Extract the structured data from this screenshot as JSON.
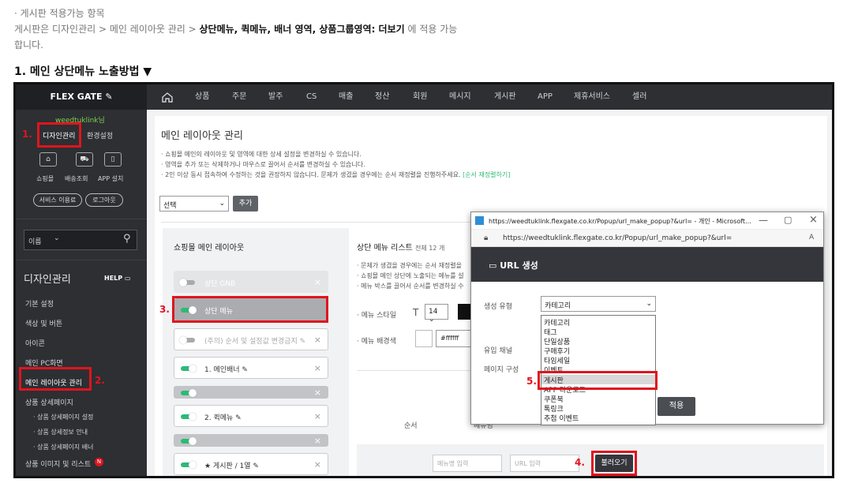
{
  "intro": {
    "line1": "· 게시판 적용가능 항목",
    "line2_pre": "게시판은 디자인관리 > 메인 레이아웃 관리 > ",
    "line2_bold": "상단메뉴, 퀵메뉴, 배너 영역, 상품그룹영역: 더보기",
    "line2_post": " 에 적용 가능",
    "line3": "합니다.",
    "heading": "1. 메인 상단메뉴 노출방법 ▼"
  },
  "topbar": {
    "logo": "FLEX GATE ✎",
    "items": [
      "상품",
      "주문",
      "발주",
      "CS",
      "매출",
      "정산",
      "회원",
      "메시지",
      "게시판",
      "APP",
      "제휴서비스",
      "셀러"
    ]
  },
  "sidebar": {
    "user": "weedtuklink님",
    "design_btn": "디자인관리",
    "env_btn": "환경설정",
    "icons": [
      "쇼핑몰",
      "배송조회",
      "APP 설치"
    ],
    "svc": "서비스 이용료",
    "logout": "로그아웃",
    "search_sel": "이름",
    "section": "디자인관리",
    "help": "HELP",
    "items": [
      "기본 설정",
      "색상 및 버튼",
      "아이콘",
      "메인 PC화면",
      "메인 레이아웃 관리",
      "상품 상세페이지",
      "· 상품 상세페이지 설정",
      "· 상품 상세정보 안내",
      "· 상품 상세페이지 배너",
      "상품 이미지 및 리스트"
    ],
    "badge": "N"
  },
  "main": {
    "title": "메인 레이아웃 관리",
    "notes": [
      "· 쇼핑몰 메인의 레이아웃 및 영역에 대한 상세 설정을 변경하실 수 있습니다.",
      "· 영역을 추가 또는 삭제하거나 마우스로 끌어서 순서를 변경하실 수 있습니다.",
      "· 2인 이상 동시 접속하여 수정하는 것을 권장하지 않습니다. 문제가 생겼을 경우에는 순서 재정렬을 진행하주세요."
    ],
    "reorder_link": "[순서 재정렬하기]",
    "select": "선택",
    "add": "추가",
    "layout_title": "쇼핑몰 메인 레이아웃",
    "rows": [
      "상단 GNB",
      "상단 메뉴",
      "(주의) 순서 및 설정값 변경금지 ✎",
      "1. 메인배너 ✎",
      "",
      "2. 퀵메뉴 ✎",
      "",
      "★ 게시판 / 1열 ✎"
    ],
    "list_title": "상단 메뉴 리스트",
    "list_count": "전체 12 개",
    "list_notes": [
      "· 문제가 생겼을 경우에는 순서 재정렬을",
      "· 쇼핑몰 메인 상단에 노출되는 메뉴를 설",
      "· 메뉴 박스를 끌어서 순서를 변경하실 수"
    ],
    "menu_style": "· 메뉴 스타일",
    "t_label": "T",
    "size": "14",
    "menu_bg": "· 메뉴 배경색",
    "color_val": "#ffffff",
    "col_order": "순서",
    "col_menu": "메뉴명",
    "in_name": "메뉴명 입력",
    "in_url": "URL 입력",
    "load_btn": "불러오기"
  },
  "popup": {
    "title": "https://weedtuklink.flexgate.co.kr/Popup/url_make_popup?&url= - 개인 - Microsoft...",
    "url": "https://weedtuklink.flexgate.co.kr/Popup/url_make_popup?&url=",
    "header": "URL 생성",
    "gen_type": "생성 유형",
    "inflow": "유입 채널",
    "page": "페이지 구성",
    "selected": "카테고리",
    "options": [
      "카테고리",
      "태그",
      "단일상품",
      "구매후기",
      "타임세일",
      "이벤트",
      "게시판",
      "APP 다운로드",
      "쿠폰북",
      "톡링크",
      "추첨 이벤트"
    ],
    "apply": "적용"
  },
  "steps": [
    "1.",
    "2.",
    "3.",
    "4.",
    "5."
  ]
}
